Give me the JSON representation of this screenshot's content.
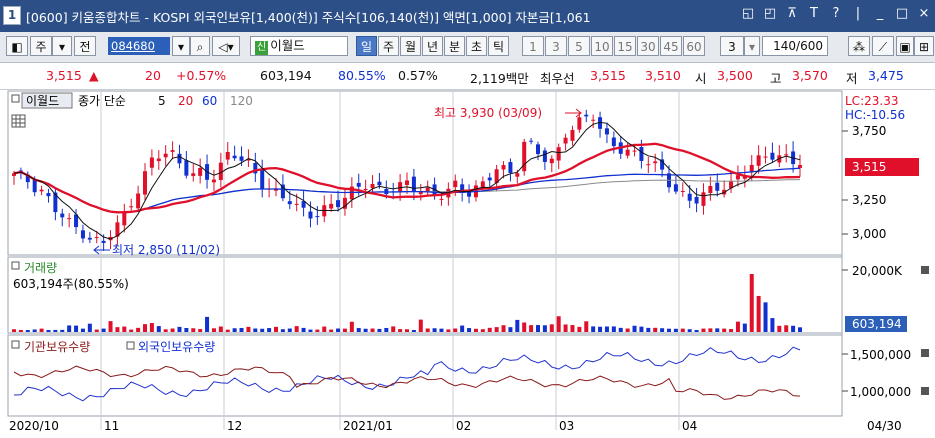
{
  "window": {
    "num": "1",
    "title": "[0600] 키움종합차트 - KOSPI 외국인보유[1,400(천)] 주식수[106,140(천)] 액면[1,000] 자본금[1,061",
    "buttons": [
      "◱",
      "◰",
      "⊼",
      "T",
      "?",
      "|",
      "_",
      "□",
      "×"
    ]
  },
  "toolbar": {
    "market": "주",
    "prev_label": "전",
    "code": "084680",
    "badge": "신",
    "stock_name": "이월드",
    "period_tabs": [
      "일",
      "주",
      "월",
      "년",
      "분",
      "초",
      "틱"
    ],
    "active_tab": "일",
    "interval_buttons": [
      "1",
      "3",
      "5",
      "10",
      "15",
      "30",
      "45",
      "60"
    ],
    "interval_select": "3",
    "page_count": "140/600"
  },
  "quote": {
    "price": "3,515",
    "arrow": "▲",
    "change": "20",
    "change_pct": "+0.57%",
    "volume": "603,194",
    "vol_ratio": "80.55%",
    "turnover_pct": "0.57%",
    "amount": "2,119백만",
    "best_ask_label": "최우선",
    "ask": "3,515",
    "bid": "3,510",
    "open_label": "시",
    "open": "3,500",
    "high_label": "고",
    "high": "3,570",
    "low_label": "저",
    "low": "3,475"
  },
  "price_panel": {
    "name": "이월드",
    "legend_title": "종가 단순",
    "ma": [
      "5",
      "20",
      "60",
      "120"
    ],
    "ma_colors": [
      "#111111",
      "#e0102a",
      "#1030d0",
      "#888888"
    ],
    "high_note": "최고 3,930 (03/09)",
    "low_note": "최저 2,850 (11/02)",
    "lc": "LC:23.33",
    "hc": "HC:-10.56",
    "y_ticks": [
      "3,750",
      "3,500",
      "3,250",
      "3,000"
    ],
    "current_tag": "3,515"
  },
  "volume_panel": {
    "name": "거래량",
    "value_text": "603,194주(80.55%)",
    "y_tick": "20,000K",
    "current_tag": "603,194"
  },
  "holding_panel": {
    "legend_inst": "기관보유수량",
    "legend_foreign": "외국인보유수량",
    "y_ticks": [
      "1,500,000",
      "1,000,000"
    ]
  },
  "x_axis": [
    "2020/10",
    "11",
    "12",
    "2021/01",
    "02",
    "03",
    "04",
    "04/30"
  ],
  "chart_data": {
    "type": "candlestick",
    "x": [
      "2020/10",
      "11",
      "12",
      "2021/01",
      "02",
      "03",
      "04",
      "04/30"
    ],
    "y_ticks": [
      3750,
      3500,
      3250,
      3000
    ],
    "ylim": [
      2850,
      3930
    ],
    "high": {
      "value": 3930,
      "date": "03/09"
    },
    "low": {
      "value": 2850,
      "date": "11/02"
    },
    "last_close": 3515,
    "close_path": [
      3450,
      3400,
      3320,
      3280,
      3200,
      3150,
      3050,
      2980,
      2900,
      2870,
      3000,
      3100,
      3250,
      3400,
      3550,
      3600,
      3580,
      3500,
      3450,
      3480,
      3420,
      3500,
      3600,
      3550,
      3500,
      3400,
      3350,
      3300,
      3250,
      3150,
      3100,
      3120,
      3200,
      3250,
      3300,
      3350,
      3350,
      3300,
      3300,
      3350,
      3400,
      3350,
      3300,
      3250,
      3280,
      3350,
      3300,
      3350,
      3400,
      3500,
      3450,
      3400,
      3700,
      3650,
      3600,
      3550,
      3750,
      3800,
      3850,
      3900,
      3750,
      3700,
      3650,
      3600,
      3550,
      3500,
      3450,
      3350,
      3300,
      3250,
      3280,
      3300,
      3320,
      3350,
      3450,
      3550,
      3580,
      3600,
      3560,
      3520,
      3515
    ],
    "volume": [
      0.06,
      0.03,
      0.04,
      0.05,
      0.03,
      0.04,
      0.1,
      0.06,
      0.12,
      0.05,
      0.18,
      0.08,
      0.05,
      0.06,
      0.14,
      0.09,
      0.05,
      0.1,
      0.06,
      0.05,
      0.22,
      0.08,
      0.04,
      0.06,
      0.1,
      0.05,
      0.06,
      0.08,
      0.05,
      0.12,
      0.06,
      0.04,
      0.08,
      0.05,
      0.06,
      0.16,
      0.06,
      0.05,
      0.06,
      0.09,
      0.05,
      0.04,
      0.18,
      0.06,
      0.05,
      0.05,
      0.12,
      0.06,
      0.05,
      0.06,
      0.1,
      0.08,
      0.2,
      0.14,
      0.1,
      0.12,
      0.24,
      0.14,
      0.1,
      0.16,
      0.09,
      0.08,
      0.12,
      0.06,
      0.1,
      0.08,
      0.06,
      0.07,
      0.05,
      0.06,
      0.04,
      0.05,
      0.06,
      0.05,
      0.06,
      0.15,
      1.0,
      0.55,
      0.2,
      0.12,
      0.1,
      0.08
    ]
  }
}
